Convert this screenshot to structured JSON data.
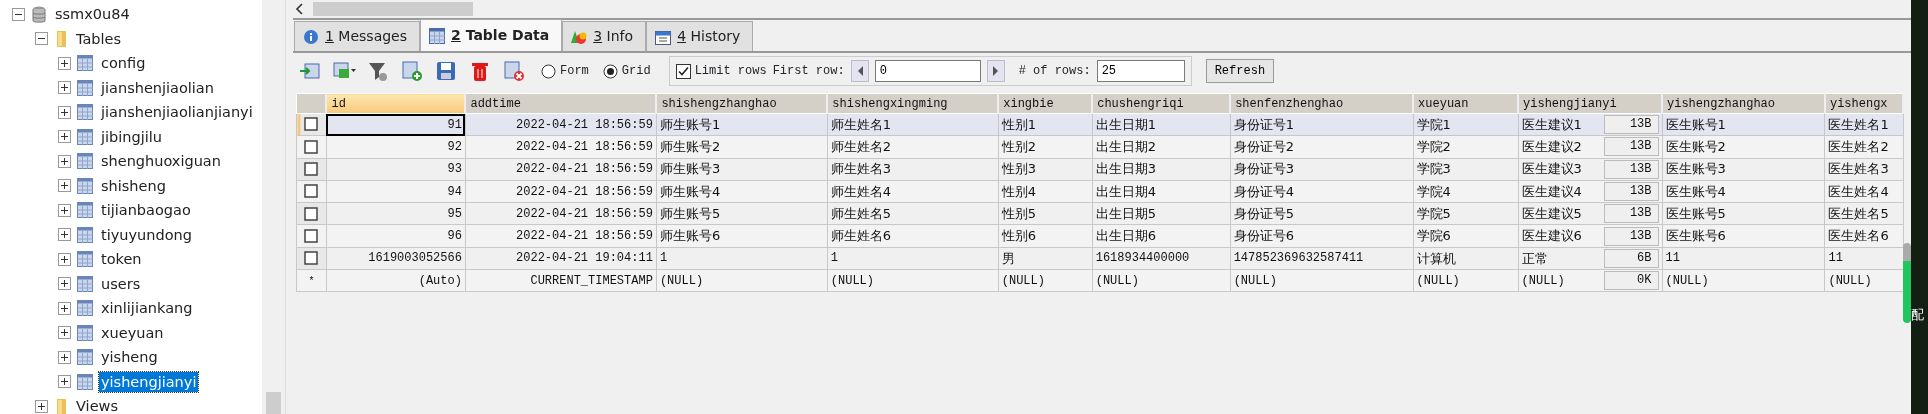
{
  "tree": [
    {
      "kind": "database",
      "label": "ssmx0u84",
      "expanded": true,
      "selected": false,
      "children": [
        {
          "kind": "folder",
          "label": "Tables",
          "expanded": true,
          "selected": false,
          "children": [
            {
              "kind": "table",
              "label": "config",
              "expanded": false,
              "selected": false
            },
            {
              "kind": "table",
              "label": "jianshenjiaolian",
              "expanded": false,
              "selected": false
            },
            {
              "kind": "table",
              "label": "jianshenjiaolianjianyi",
              "expanded": false,
              "selected": false
            },
            {
              "kind": "table",
              "label": "jibingjilu",
              "expanded": false,
              "selected": false
            },
            {
              "kind": "table",
              "label": "shenghuoxiguan",
              "expanded": false,
              "selected": false
            },
            {
              "kind": "table",
              "label": "shisheng",
              "expanded": false,
              "selected": false
            },
            {
              "kind": "table",
              "label": "tijianbaogao",
              "expanded": false,
              "selected": false
            },
            {
              "kind": "table",
              "label": "tiyuyundong",
              "expanded": false,
              "selected": false
            },
            {
              "kind": "table",
              "label": "token",
              "expanded": false,
              "selected": false
            },
            {
              "kind": "table",
              "label": "users",
              "expanded": false,
              "selected": false
            },
            {
              "kind": "table",
              "label": "xinlijiankang",
              "expanded": false,
              "selected": false
            },
            {
              "kind": "table",
              "label": "xueyuan",
              "expanded": false,
              "selected": false
            },
            {
              "kind": "table",
              "label": "yisheng",
              "expanded": false,
              "selected": false
            },
            {
              "kind": "table",
              "label": "yishengjianyi",
              "expanded": false,
              "selected": true
            }
          ]
        },
        {
          "kind": "folder",
          "label": "Views",
          "expanded": false,
          "selected": false
        }
      ]
    }
  ],
  "tabs": [
    {
      "kind": "info",
      "key": "1",
      "label": "Messages",
      "selected": false
    },
    {
      "kind": "grid",
      "key": "2",
      "label": "Table Data",
      "selected": true
    },
    {
      "kind": "shapes",
      "key": "3",
      "label": "Info",
      "selected": false
    },
    {
      "kind": "calendar",
      "key": "4",
      "label": "History",
      "selected": false
    }
  ],
  "toolbar": {
    "view_modes": [
      {
        "label": "Form",
        "selected": false
      },
      {
        "label": "Grid",
        "selected": true
      }
    ],
    "limit_rows": {
      "label": "Limit rows",
      "checked": true
    },
    "first_row_label": "First row:",
    "first_row": "0",
    "rows_label": "# of rows:",
    "rows": "25",
    "refresh": "Refresh"
  },
  "table": {
    "columns": [
      {
        "name": "id",
        "kind": "numeric",
        "selected": true
      },
      {
        "name": "addtime",
        "kind": "timestamp",
        "selected": false
      },
      {
        "name": "shishengzhanghao",
        "kind": "text",
        "selected": false
      },
      {
        "name": "shishengxingming",
        "kind": "text",
        "selected": false
      },
      {
        "name": "xingbie",
        "kind": "text",
        "selected": false
      },
      {
        "name": "chushengriqi",
        "kind": "text",
        "selected": false
      },
      {
        "name": "shenfenzhenghao",
        "kind": "text",
        "selected": false
      },
      {
        "name": "xueyuan",
        "kind": "text",
        "selected": false
      },
      {
        "name": "yishengjianyi",
        "kind": "blob",
        "selected": false
      },
      {
        "name": "yishengzhanghao",
        "kind": "text",
        "selected": false
      },
      {
        "name": "yishengx",
        "kind": "text",
        "selected": false
      }
    ],
    "rows": [
      {
        "kind": "data",
        "checked": false,
        "selected": true,
        "cells": [
          "91",
          "2022-04-21 18:56:59",
          "师生账号1",
          "师生姓名1",
          "性别1",
          "出生日期1",
          "身份证号1",
          "学院1",
          {
            "text": "医生建议1",
            "size": "13B"
          },
          "医生账号1",
          "医生姓名1"
        ]
      },
      {
        "kind": "data",
        "checked": false,
        "selected": false,
        "cells": [
          "92",
          "2022-04-21 18:56:59",
          "师生账号2",
          "师生姓名2",
          "性别2",
          "出生日期2",
          "身份证号2",
          "学院2",
          {
            "text": "医生建议2",
            "size": "13B"
          },
          "医生账号2",
          "医生姓名2"
        ]
      },
      {
        "kind": "data",
        "checked": false,
        "selected": false,
        "cells": [
          "93",
          "2022-04-21 18:56:59",
          "师生账号3",
          "师生姓名3",
          "性别3",
          "出生日期3",
          "身份证号3",
          "学院3",
          {
            "text": "医生建议3",
            "size": "13B"
          },
          "医生账号3",
          "医生姓名3"
        ]
      },
      {
        "kind": "data",
        "checked": false,
        "selected": false,
        "cells": [
          "94",
          "2022-04-21 18:56:59",
          "师生账号4",
          "师生姓名4",
          "性别4",
          "出生日期4",
          "身份证号4",
          "学院4",
          {
            "text": "医生建议4",
            "size": "13B"
          },
          "医生账号4",
          "医生姓名4"
        ]
      },
      {
        "kind": "data",
        "checked": false,
        "selected": false,
        "cells": [
          "95",
          "2022-04-21 18:56:59",
          "师生账号5",
          "师生姓名5",
          "性别5",
          "出生日期5",
          "身份证号5",
          "学院5",
          {
            "text": "医生建议5",
            "size": "13B"
          },
          "医生账号5",
          "医生姓名5"
        ]
      },
      {
        "kind": "data",
        "checked": false,
        "selected": false,
        "cells": [
          "96",
          "2022-04-21 18:56:59",
          "师生账号6",
          "师生姓名6",
          "性别6",
          "出生日期6",
          "身份证号6",
          "学院6",
          {
            "text": "医生建议6",
            "size": "13B"
          },
          "医生账号6",
          "医生姓名6"
        ]
      },
      {
        "kind": "data",
        "checked": false,
        "selected": false,
        "cells": [
          "1619003052566",
          "2022-04-21 19:04:11",
          "1",
          "1",
          "男",
          "1618934400000",
          "147852369632587411",
          "计算机",
          {
            "text": "正常",
            "size": "6B"
          },
          "11",
          "11"
        ]
      },
      {
        "kind": "new",
        "marker": "*",
        "selected": false,
        "cells": [
          "(Auto)",
          "CURRENT_TIMESTAMP",
          "(NULL)",
          "(NULL)",
          "(NULL)",
          "(NULL)",
          "(NULL)",
          "(NULL)",
          {
            "text": "(NULL)",
            "size": "0K"
          },
          "(NULL)",
          "(NULL)"
        ]
      }
    ]
  },
  "desktop_text": "配"
}
